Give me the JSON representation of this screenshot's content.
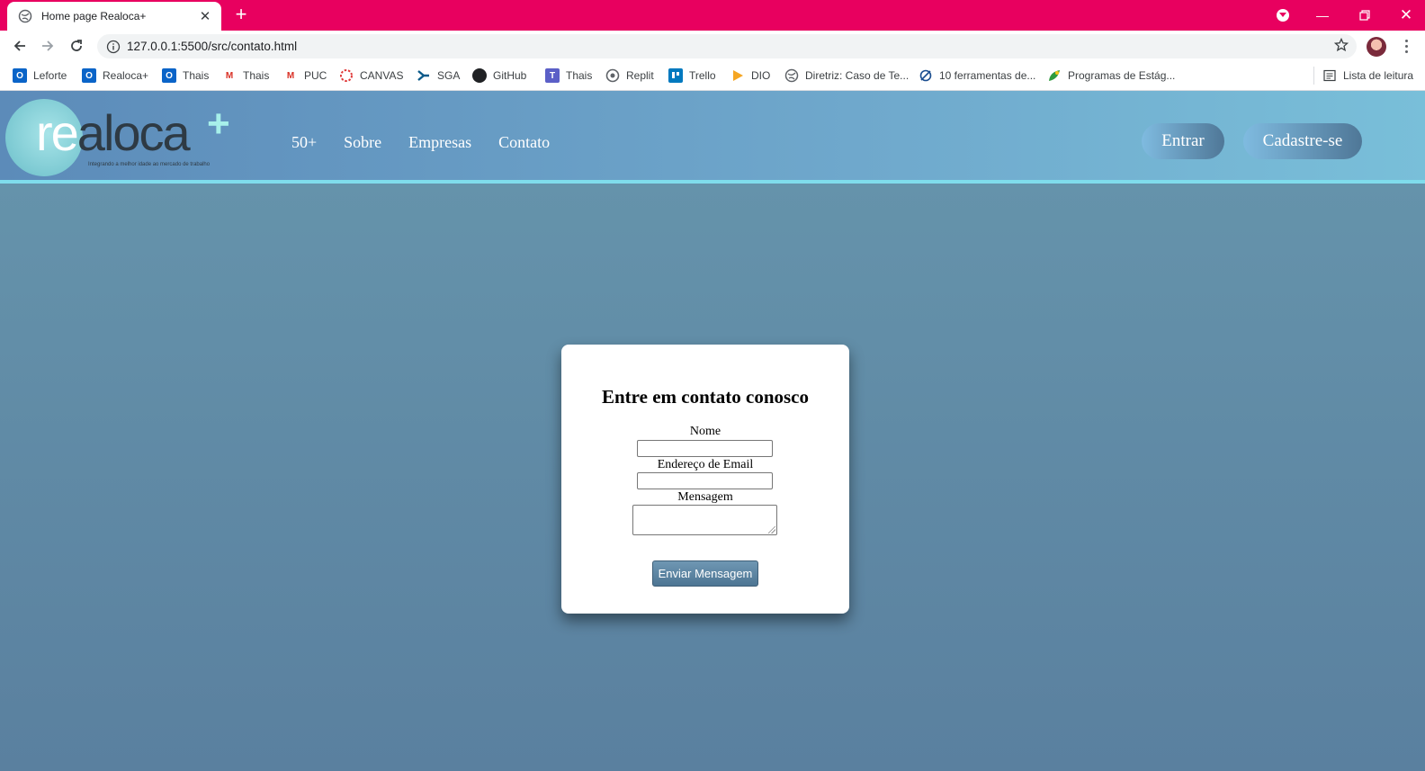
{
  "browser": {
    "tab_title": "Home page Realoca+",
    "url": "127.0.0.1:5500/src/contato.html",
    "tab_bar_color": "#e8005f"
  },
  "bookmarks": [
    {
      "label": "Leforte",
      "icon": "outlook-icon",
      "color": "#0a64c8"
    },
    {
      "label": "Realoca+",
      "icon": "outlook-icon",
      "color": "#0a64c8"
    },
    {
      "label": "Thais",
      "icon": "outlook-icon",
      "color": "#0a64c8"
    },
    {
      "label": "Thais",
      "icon": "gmail-icon",
      "color": "#d93025"
    },
    {
      "label": "PUC",
      "icon": "gmail-icon",
      "color": "#d93025"
    },
    {
      "label": "CANVAS",
      "icon": "canvas-icon",
      "color": "#e03a3a"
    },
    {
      "label": "SGA",
      "icon": "sga-icon",
      "color": "#0b5a8a"
    },
    {
      "label": "GitHub",
      "icon": "github-icon",
      "color": "#202124"
    },
    {
      "label": "Thais",
      "icon": "teams-icon",
      "color": "#5b5fc7"
    },
    {
      "label": "Replit",
      "icon": "globe-icon",
      "color": "#5f6368"
    },
    {
      "label": "Trello",
      "icon": "trello-icon",
      "color": "#0079bf"
    },
    {
      "label": "DIO",
      "icon": "dio-icon",
      "color": "#f5a623"
    },
    {
      "label": "Diretriz: Caso de Te...",
      "icon": "globe-icon",
      "color": "#5f6368"
    },
    {
      "label": "10 ferramentas de...",
      "icon": "tool-icon",
      "color": "#1a4d8f"
    },
    {
      "label": "Programas de Estág...",
      "icon": "leaf-icon",
      "color": "#2e9b3e"
    }
  ],
  "reading_list": "Lista de leitura",
  "site": {
    "logo_re": "re",
    "logo_aloca": "aloca",
    "logo_plus": "+",
    "logo_tagline": "Integrando a melhor idade ao mercado de trabalho",
    "nav": [
      "50+",
      "Sobre",
      "Empresas",
      "Contato"
    ],
    "login_label": "Entrar",
    "signup_label": "Cadastre-se"
  },
  "contact": {
    "title": "Entre em contato conosco",
    "name_label": "Nome",
    "email_label": "Endereço de Email",
    "message_label": "Mensagem",
    "submit_label": "Enviar Mensagem"
  }
}
